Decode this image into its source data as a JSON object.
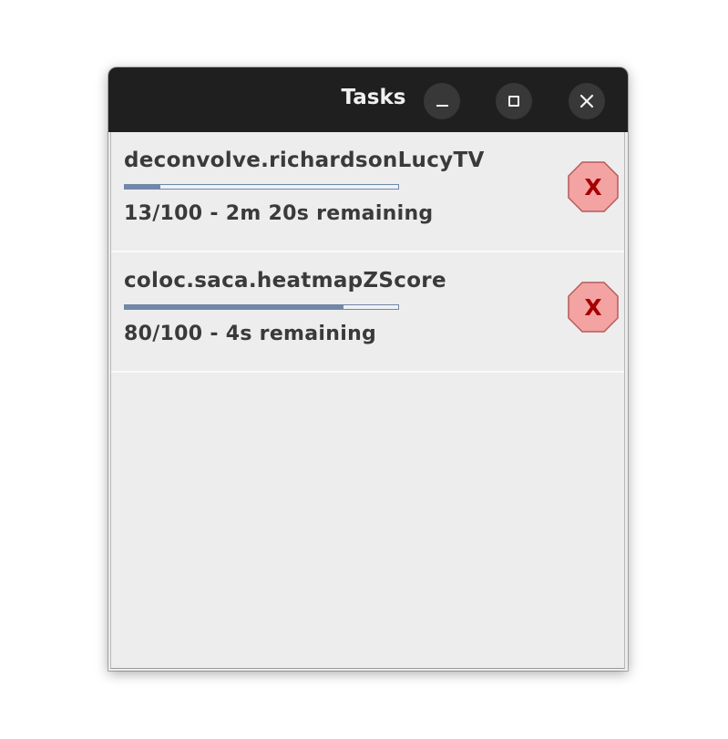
{
  "window": {
    "title": "Tasks"
  },
  "tasks": [
    {
      "name": "deconvolve.richardsonLucyTV",
      "status": "13/100 - 2m 20s remaining",
      "progress": 0.13,
      "cancel_label": "X"
    },
    {
      "name": "coloc.saca.heatmapZScore",
      "status": "80/100 - 4s remaining",
      "progress": 0.8,
      "cancel_label": "X"
    }
  ],
  "colors": {
    "titlebar": "#1f1f1f",
    "progress_fill": "#7288ab",
    "cancel_fill": "#f4a3a3",
    "cancel_text": "#a80000"
  }
}
